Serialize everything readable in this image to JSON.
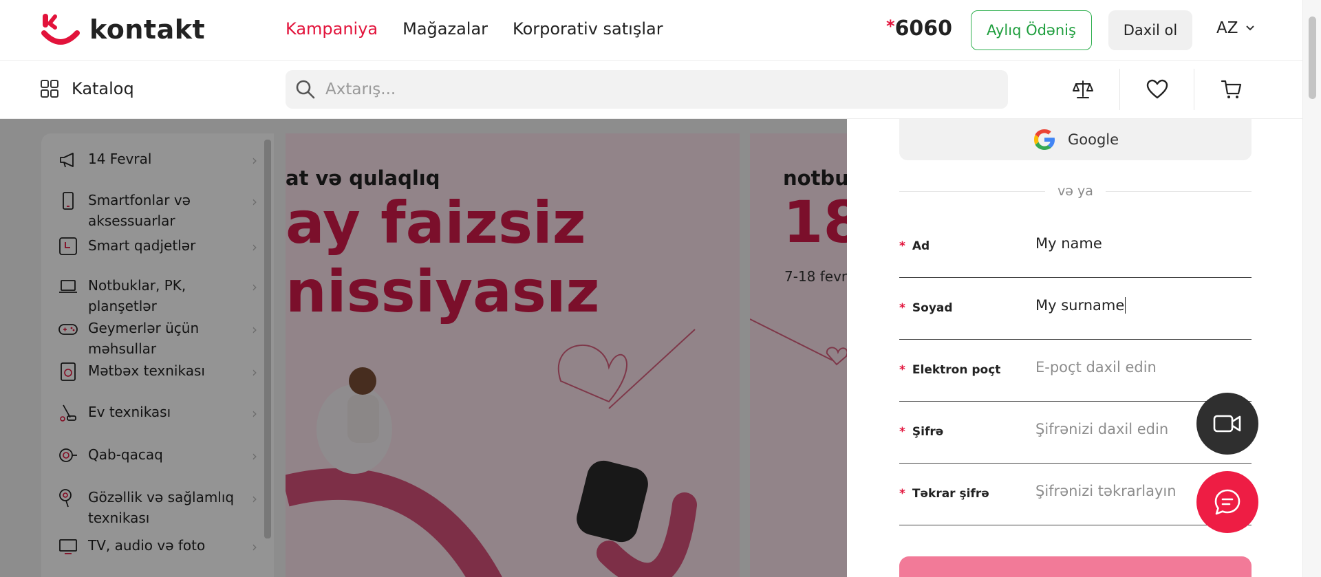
{
  "brand": {
    "name": "kontakt",
    "accent": "#e2133b"
  },
  "nav": {
    "items": [
      {
        "label": "Kampaniya",
        "active": true
      },
      {
        "label": "Mağazalar",
        "active": false
      },
      {
        "label": "Korporativ satışlar",
        "active": false
      }
    ]
  },
  "phone": {
    "star": "*",
    "number": "6060"
  },
  "header": {
    "monthly_payment": "Aylıq Ödəniş",
    "login": "Daxil ol",
    "lang": "AZ"
  },
  "catalog": {
    "label": "Kataloq"
  },
  "search": {
    "placeholder": "Axtarış..."
  },
  "sidebar": {
    "items": [
      {
        "label": "14 Fevral",
        "icon": "megaphone-icon"
      },
      {
        "label": "Smartfonlar və aksessuarlar",
        "icon": "smartphone-icon"
      },
      {
        "label": "Smart qadjetlər",
        "icon": "smartwatch-icon"
      },
      {
        "label": "Notbuklar, PK, planşetlər",
        "icon": "laptop-icon"
      },
      {
        "label": "Geymerlər üçün məhsullar",
        "icon": "gamepad-icon"
      },
      {
        "label": "Mətbəx texnikası",
        "icon": "kitchen-appliance-icon"
      },
      {
        "label": "Ev texnikası",
        "icon": "vacuum-icon"
      },
      {
        "label": "Qab-qacaq",
        "icon": "cookware-icon"
      },
      {
        "label": "Gözəllik və sağlamlıq texnikası",
        "icon": "hairdryer-icon"
      },
      {
        "label": "TV, audio və foto",
        "icon": "tv-icon"
      }
    ]
  },
  "banner1": {
    "subtitle": "at və qulaqlıq",
    "line1": "ay faizsiz",
    "line2": "nissiyasız"
  },
  "banner2": {
    "subtitle": "notbu",
    "big": "18",
    "date": "7-18 fevr"
  },
  "register": {
    "google_label": "Google",
    "or_text": "və ya",
    "fields": [
      {
        "label": "Ad",
        "value": "My name",
        "placeholder": ""
      },
      {
        "label": "Soyad",
        "value": "My surname",
        "placeholder": ""
      },
      {
        "label": "Elektron poçt",
        "value": "",
        "placeholder": "E-poçt daxil edin"
      },
      {
        "label": "Şifrə",
        "value": "",
        "placeholder": "Şifrənizi daxil edin"
      },
      {
        "label": "Təkrar şifrə",
        "value": "",
        "placeholder": "Şifrənizi təkrarlayın"
      }
    ],
    "required_mark": "*"
  }
}
